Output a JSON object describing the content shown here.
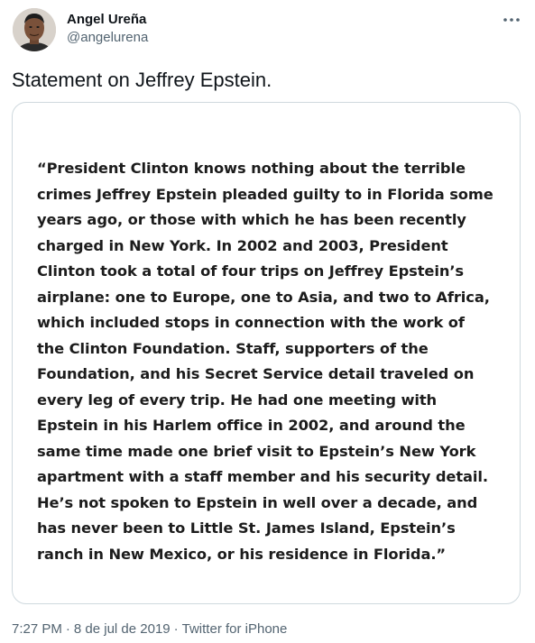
{
  "author": {
    "display_name": "Angel Ureña",
    "handle": "@angelurena"
  },
  "tweet": {
    "text": "Statement on Jeffrey Epstein.",
    "media_text_lines": [
      "“President Clinton knows nothing about the terrible",
      "crimes Jeffrey Epstein pleaded guilty to in Florida some",
      "years ago, or those with which he has been recently",
      "charged in New York. In 2002 and 2003, President",
      "Clinton took a total of four trips on Jeffrey Epstein’s",
      "airplane: one to Europe, one to Asia, and two to Africa,",
      "which included stops in connection with the work of",
      "the Clinton Foundation. Staff, supporters of the",
      "Foundation, and his Secret Service detail traveled on",
      "every leg of every trip. He had one meeting with",
      "Epstein in his Harlem office in 2002, and around the",
      "same time made one brief visit to Epstein’s New York",
      "apartment with a staff member and his security detail.",
      "He’s not spoken to Epstein in well over a decade, and",
      "has never been to Little St. James Island, Epstein’s",
      "ranch in New Mexico, or his residence in Florida.”"
    ]
  },
  "meta": {
    "time": "7:27 PM",
    "date": "8 de jul de 2019",
    "source": "Twitter for iPhone",
    "separator": "·"
  },
  "icons": {
    "more": "more-horizontal-icon",
    "avatar": "profile-photo"
  },
  "colors": {
    "text_primary": "#0f1419",
    "text_secondary": "#536471",
    "border": "#cfd9de"
  }
}
